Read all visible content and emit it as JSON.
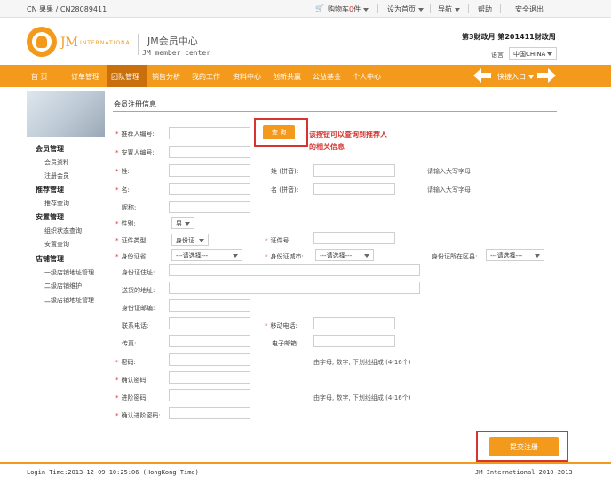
{
  "topbar": {
    "brand": "CN 果果 / CN28089411",
    "cart": "购物车",
    "cart_count": "0",
    "cart_unit": "件",
    "homepage": "设为首页",
    "nav": "导航",
    "help": "帮助",
    "logout": "安全退出"
  },
  "header": {
    "logo_text": "JM",
    "logo_sub": "INTERNATIONAL",
    "title": "JM会员中心",
    "subtitle": "JM member center",
    "period": "第3财政月  第201411财政周",
    "lang_label": "语言",
    "lang_value": "中国CHINA"
  },
  "nav": {
    "items": [
      "首  页",
      "订单管理",
      "团队管理",
      "销售分析",
      "我的工作",
      "资料中心",
      "创新共赢",
      "公益基金",
      "个人中心"
    ],
    "quick": "快捷入口"
  },
  "sidebar": {
    "groups": [
      {
        "title": "会员管理",
        "items": [
          "会员资料",
          "注册会员"
        ]
      },
      {
        "title": "推荐管理",
        "items": [
          "推荐查询"
        ]
      },
      {
        "title": "安置管理",
        "items": [
          "组织状态查询",
          "安置查询"
        ]
      },
      {
        "title": "店铺管理",
        "items": [
          "一级店铺地址管理",
          "二级店铺维护",
          "二级店铺地址管理"
        ]
      }
    ]
  },
  "form": {
    "title": "会员注册信息",
    "query_button": "查 询",
    "annotation": "该按钮可以查询到推荐人的相关信息",
    "fields": {
      "recommender": "推荐人编号:",
      "placement": "安置人编号:",
      "surname": "姓:",
      "surname_pinyin": "姓 (拼音):",
      "name": "名:",
      "name_pinyin": "名 (拼音):",
      "nickname": "昵称:",
      "gender": "性别:",
      "id_type": "证件类型:",
      "id_number": "证件号:",
      "id_province": "身份证省:",
      "id_city": "身份证城市:",
      "id_district": "身份证所在区县:",
      "id_address": "身份证住址:",
      "delivery_address": "送货的地址:",
      "id_postcode": "身份证邮编:",
      "phone": "联系电话:",
      "mobile": "移动电话:",
      "fax": "传真:",
      "email": "电子邮箱:",
      "password": "密码:",
      "confirm_password": "确认密码:",
      "advanced_password": "进阶密码:",
      "confirm_advanced_password": "确认进阶密码:"
    },
    "gender_value": "男",
    "id_type_value": "身份证",
    "select_placeholder": "---请选择---",
    "hint_upper": "请输入大写字母",
    "hint_password": "由字母, 数字, 下划线组成 (4-16个)",
    "submit": "提交注册"
  },
  "footer": {
    "login_time": "Login Time:2013-12-09 10:25:06 (HongKong Time)",
    "copyright": "JM International 2010-2013"
  },
  "colors": {
    "accent": "#f39a1c",
    "nav_active": "#c9700c",
    "annotation": "#d4352f"
  }
}
